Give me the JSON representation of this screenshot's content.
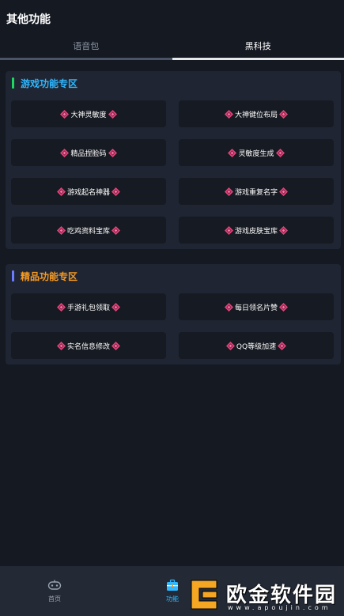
{
  "header": {
    "title": "其他功能"
  },
  "tabs": [
    {
      "label": "语音包",
      "active": false
    },
    {
      "label": "黑科技",
      "active": true
    }
  ],
  "sections": [
    {
      "title": "游戏功能专区",
      "buttons": [
        "大神灵敏度",
        "大神键位布局",
        "精品捏脸码",
        "灵敏度生成",
        "游戏起名神器",
        "游戏重复名字",
        "吃鸡资料宝库",
        "游戏皮肤宝库"
      ]
    },
    {
      "title": "精品功能专区",
      "buttons": [
        "手游礼包领取",
        "每日领名片赞",
        "实名信息修改",
        "QQ等级加速"
      ]
    }
  ],
  "bottom_nav": [
    {
      "label": "首页",
      "icon": "gamepad-icon"
    },
    {
      "label": "功能",
      "icon": "toolbox-icon"
    }
  ],
  "watermark": {
    "text": "欧金软件园",
    "url": "www.apoujin.com"
  },
  "colors": {
    "accent_blue": "#2fb7ff",
    "accent_orange": "#f59a23",
    "gem_pink": "#e0457b"
  }
}
